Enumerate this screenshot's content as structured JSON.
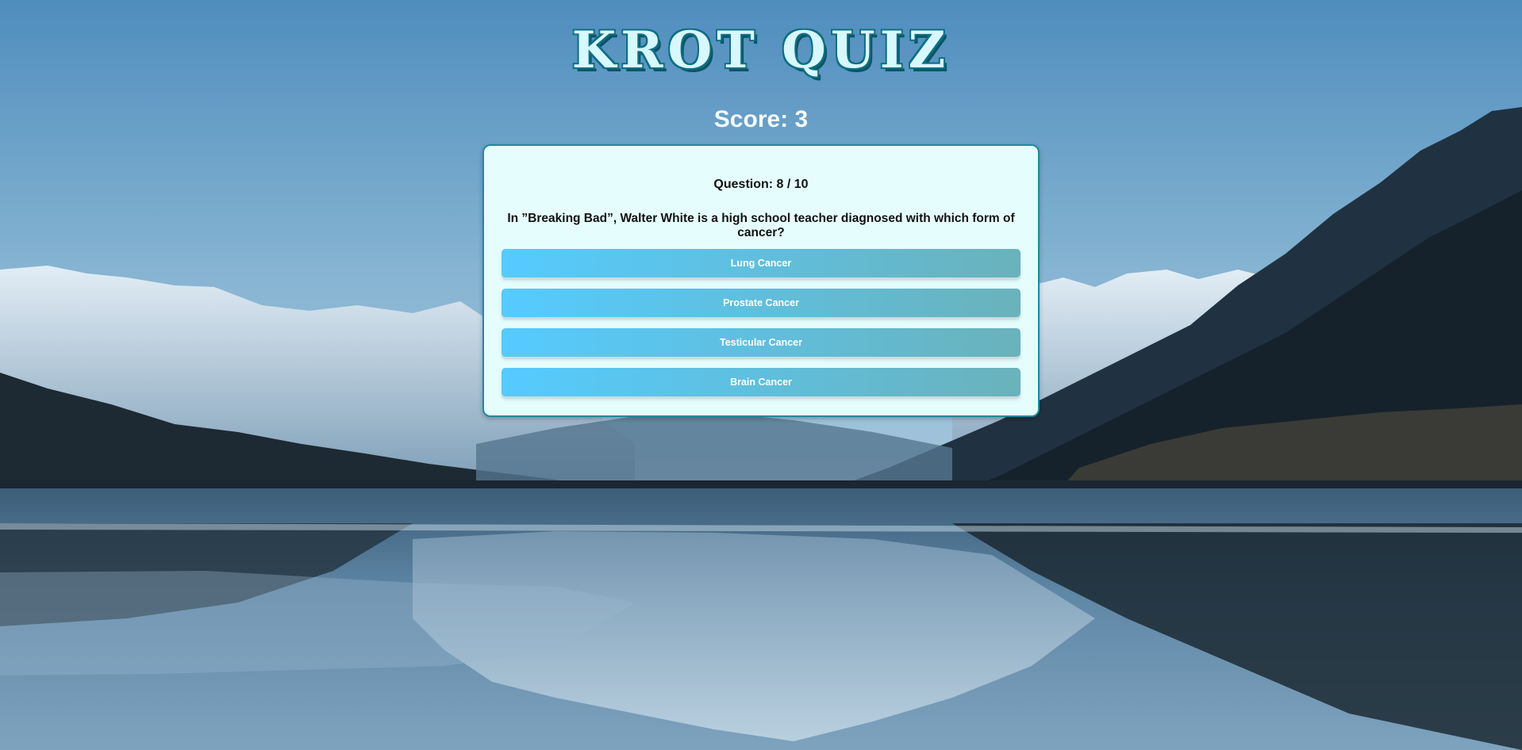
{
  "app": {
    "title": "KROT QUIZ"
  },
  "score": {
    "label": "Score: 3"
  },
  "quiz": {
    "progress_label": "Question: 8 / 10",
    "question": "In ”Breaking Bad”, Walter White is a high school teacher diagnosed with which form of cancer?",
    "answers": [
      {
        "label": "Lung Cancer"
      },
      {
        "label": "Prostate Cancer"
      },
      {
        "label": "Testicular Cancer"
      },
      {
        "label": "Brain Cancer"
      }
    ]
  },
  "colors": {
    "title_fill": "#d8f8ff",
    "title_outline": "#0e6f84",
    "card_background": "#e6fdfe",
    "card_border": "#1f8aa0",
    "answer_gradient_start": "#55cbff",
    "answer_gradient_end": "#6ab2bb"
  },
  "background": {
    "description_icon": "mountain-lake-landscape"
  }
}
